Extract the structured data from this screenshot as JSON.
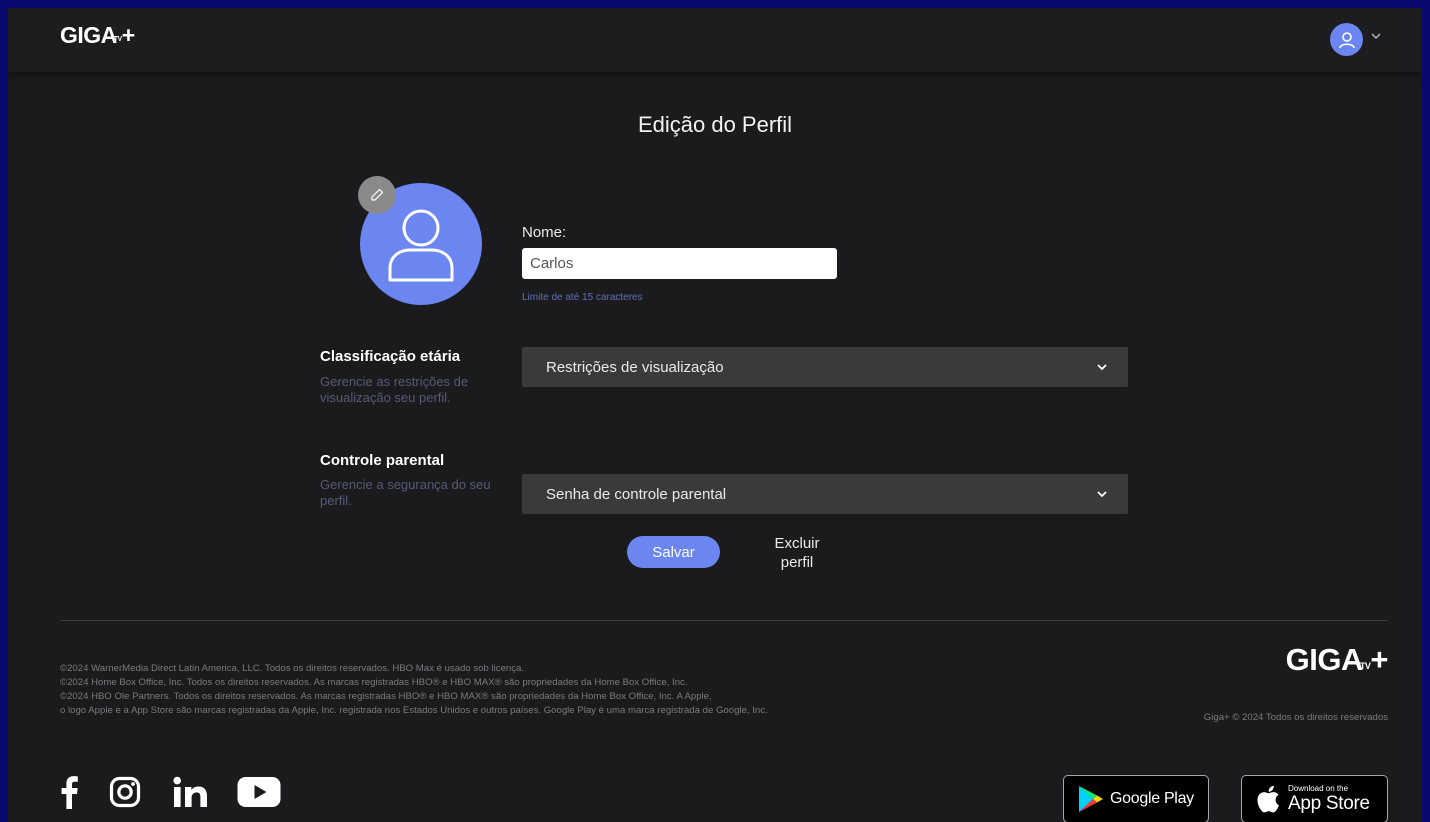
{
  "header": {
    "logo": {
      "main": "GIGA",
      "tv": "TV",
      "plus": "+"
    }
  },
  "profile": {
    "title": "Edição do Perfil",
    "name_label": "Nome:",
    "name_value": "Carlos",
    "name_hint": "Limite de até 15 caracteres"
  },
  "age_rating": {
    "title": "Classificação etária",
    "description": "Gerencie as restrições de visualização seu perfil.",
    "select_label": "Restrições de visualização"
  },
  "parental": {
    "title": "Controle parental",
    "description": "Gerencie a segurança do seu perfil.",
    "select_label": "Senha de controle parental"
  },
  "actions": {
    "save_label": "Salvar",
    "delete_line1": "Excluir",
    "delete_line2": "perfil"
  },
  "footer": {
    "legal": [
      "©2024 WarnerMedia Direct Latin America, LLC. Todos os direitos reservados. HBO Max é usado sob licença.",
      "©2024 Home Box Office, Inc. Todos os direitos reservados. As marcas registradas HBO® e HBO MAX® são propriedades da Home Box Office, Inc.",
      "©2024 HBO Ole Partners. Todos os direitos reservados. As marcas registradas HBO® e HBO MAX® são propriedades da Home Box Office, Inc. A Apple,",
      "o logo Apple e a App Store são marcas registradas da Apple, Inc. registrada nos Estados Unidos e outros países. Google Play é uma marca registrada de Google, Inc."
    ],
    "copyright": "Giga+ © 2024 Todos os direitos reservados",
    "logo": {
      "main": "GIGA",
      "tv": "TV",
      "plus": "+"
    },
    "google_play_label": "Google Play",
    "app_store_small": "Download on the",
    "app_store_label": "App Store"
  },
  "colors": {
    "accent": "#6b86f0",
    "background": "#1b1b1d",
    "select_bg": "#3a3a3c"
  },
  "icons": [
    "user-icon",
    "pencil-icon",
    "chevron-down-icon",
    "facebook-icon",
    "instagram-icon",
    "linkedin-icon",
    "youtube-icon",
    "google-play-icon",
    "apple-icon"
  ]
}
